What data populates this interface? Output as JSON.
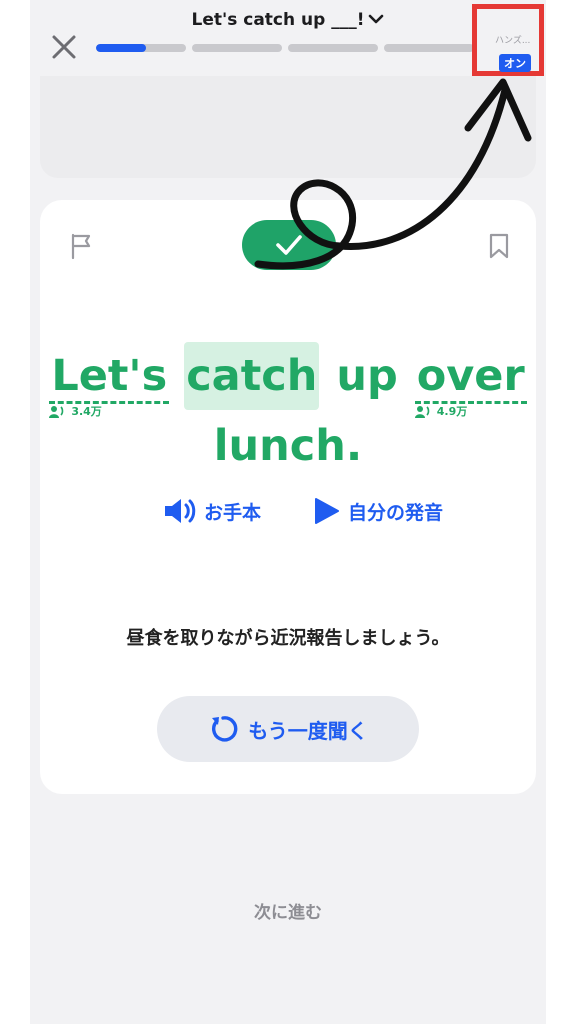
{
  "header": {
    "title": "Let's catch up ___!",
    "progress": [
      0.55,
      0,
      0,
      0
    ]
  },
  "hands_free": {
    "label": "ハンズ...",
    "toggle": "オン"
  },
  "card": {
    "sentence_line1": [
      {
        "text": "Let's",
        "style": "dotted",
        "pron_count": ""
      },
      {
        "text": "catch",
        "style": "highlight",
        "pron_count": ""
      },
      {
        "text": "up",
        "style": "plain",
        "pron_count": ""
      },
      {
        "text": "over",
        "style": "dotted",
        "pron_count": ""
      }
    ],
    "pron_counts": {
      "lets": "3.4万",
      "over": "4.9万"
    },
    "sentence_line2": "lunch.",
    "model_audio": "お手本",
    "my_pronunciation": "自分の発音",
    "translation": "昼食を取りながら近況報告しましょう。",
    "replay": "もう一度聞く"
  },
  "footer": {
    "next": "次に進む"
  },
  "colors": {
    "accent_blue": "#1f5cf0",
    "success_green": "#21a865",
    "highlight_red": "#e53935"
  },
  "icons": [
    "close-icon",
    "chevron-down-icon",
    "flag-icon",
    "check-icon",
    "bookmark-icon",
    "speaker-icon",
    "play-icon",
    "listener-icon",
    "replay-icon",
    "curved-arrow-icon"
  ]
}
